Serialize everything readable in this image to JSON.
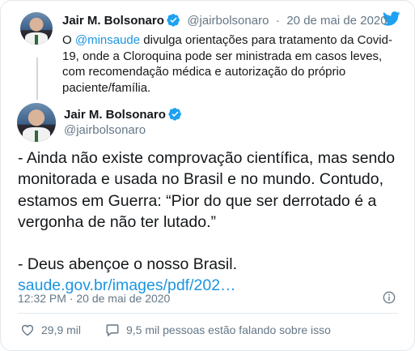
{
  "quoted_tweet": {
    "author_name": "Jair M. Bolsonaro",
    "author_handle": "@jairbolsonaro",
    "separator": "·",
    "date": "20 de mai de 2020",
    "text_prefix": "O ",
    "mention": "@minsaude",
    "text_rest": " divulga orientações para tratamento da Covid-19, onde a Cloroquina pode ser ministrada em casos leves, com recomendação médica e autorização do próprio paciente/família."
  },
  "main_tweet": {
    "author_name": "Jair M. Bolsonaro",
    "author_handle": "@jairbolsonaro",
    "paragraph_1": "- Ainda não existe comprovação científica, mas sendo monitorada e usada no Brasil e no mundo. Contudo, estamos em Guerra: “Pior do que ser derrotado é a vergonha de não ter lutado.”",
    "paragraph_2": "- Deus abençoe o nosso Brasil.",
    "link": "saude.gov.br/images/pdf/202…",
    "timestamp": "12:32 PM · 20 de mai de 2020"
  },
  "actions": {
    "likes": "29,9 mil",
    "talking": "9,5 mil pessoas estão falando sobre isso"
  },
  "colors": {
    "accent": "#1da1f2",
    "link": "#1b95e0",
    "secondary_text": "#657786",
    "border": "#e1e8ed"
  },
  "icons": [
    "twitter-bird-icon",
    "verified-badge-icon",
    "info-icon",
    "heart-icon",
    "speech-bubble-icon"
  ]
}
